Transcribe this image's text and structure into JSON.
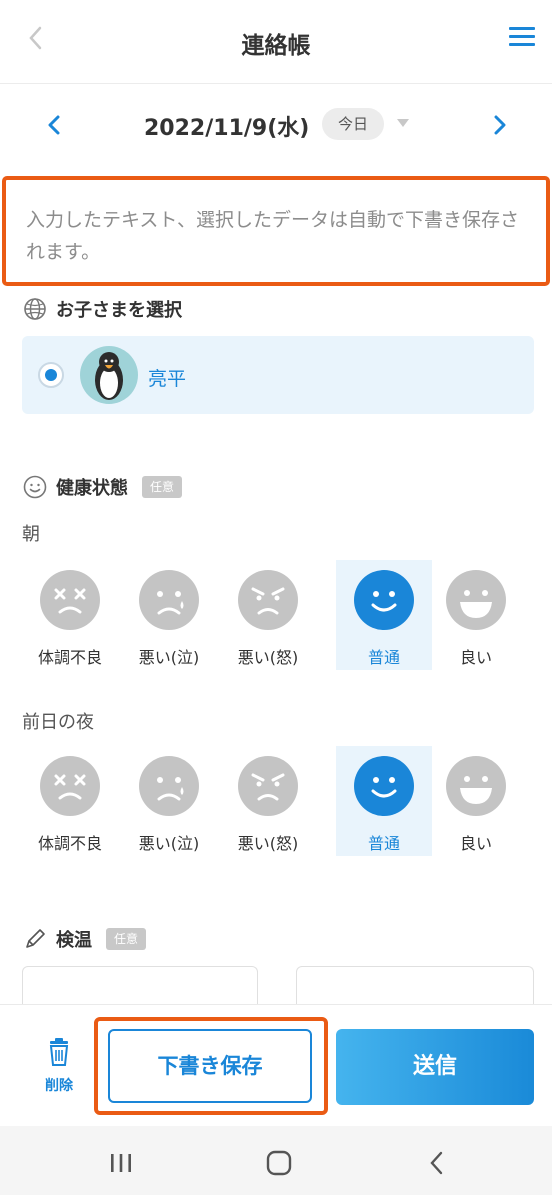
{
  "header": {
    "title": "連絡帳"
  },
  "datebar": {
    "date": "2022/11/9(水)",
    "today_label": "今日"
  },
  "notice": {
    "text": "入力したテキスト、選択したデータは自動で下書き保存されます。"
  },
  "child_section": {
    "title": "お子さまを選択",
    "child_name": "亮平"
  },
  "health": {
    "title": "健康状態",
    "badge": "任意",
    "morning": {
      "label": "朝",
      "options": [
        "体調不良",
        "悪い(泣)",
        "悪い(怒)",
        "普通",
        "良い"
      ],
      "selected": "普通"
    },
    "night": {
      "label": "前日の夜",
      "options": [
        "体調不良",
        "悪い(泣)",
        "悪い(怒)",
        "普通",
        "良い"
      ],
      "selected": "普通"
    }
  },
  "temperature": {
    "title": "検温",
    "badge": "任意"
  },
  "footer": {
    "delete_label": "削除",
    "draft_label": "下書き保存",
    "send_label": "送信"
  },
  "colors": {
    "accent": "#1a86d8",
    "highlight": "#ea5b14",
    "face_gray": "#c4c4c4",
    "selected_bg": "#e9f4fc"
  }
}
